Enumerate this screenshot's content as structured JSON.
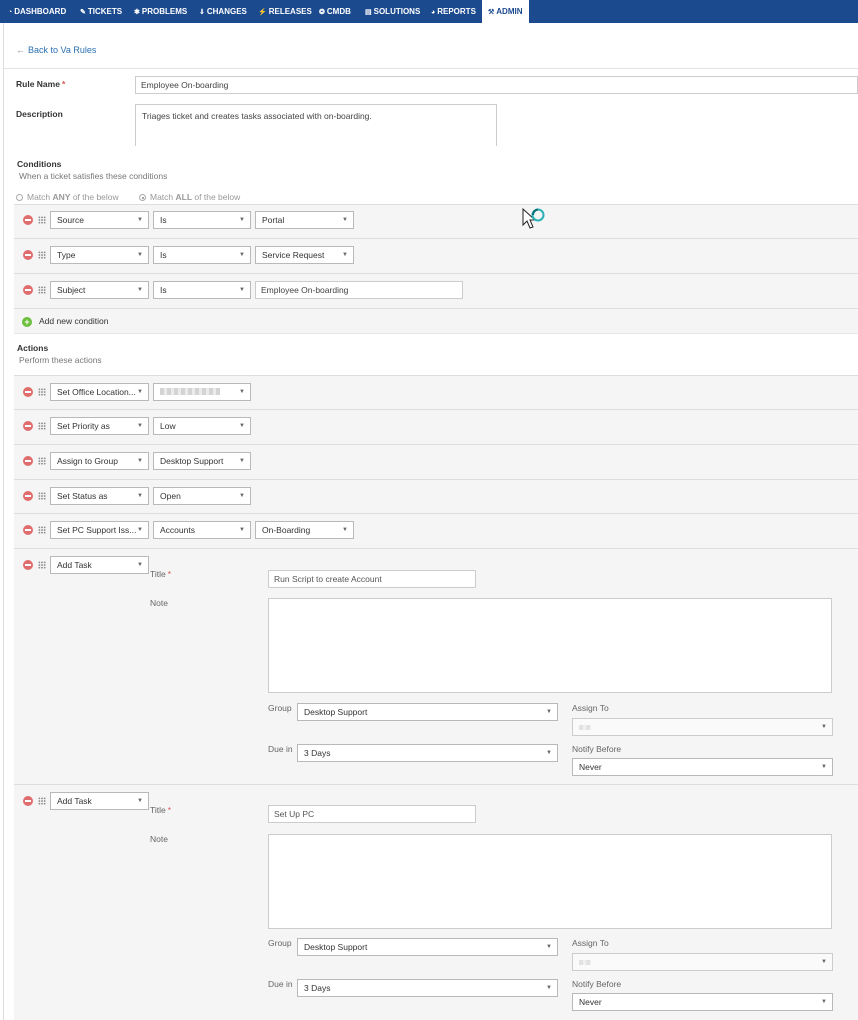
{
  "nav": {
    "items": [
      {
        "label": "DASHBOARD"
      },
      {
        "label": "TICKETS"
      },
      {
        "label": "PROBLEMS"
      },
      {
        "label": "CHANGES"
      },
      {
        "label": "RELEASES"
      },
      {
        "label": "CMDB"
      },
      {
        "label": "SOLUTIONS"
      },
      {
        "label": "REPORTS"
      },
      {
        "label": "ADMIN"
      }
    ]
  },
  "back_link": "Back to Va Rules",
  "form": {
    "rule_name_label": "Rule Name",
    "rule_name_value": "Employee On-boarding",
    "description_label": "Description",
    "description_value": "Triages ticket and creates tasks associated with on-boarding.",
    "required_mark": "*"
  },
  "conditions": {
    "heading": "Conditions",
    "subheading": "When a ticket satisfies these conditions",
    "match_any_pre": "Match ",
    "match_any_bold": "ANY",
    "match_any_post": " of the below",
    "match_all_pre": "Match ",
    "match_all_bold": "ALL",
    "match_all_post": " of the below",
    "rows": [
      {
        "field": "Source",
        "operator": "Is",
        "value": "Portal"
      },
      {
        "field": "Type",
        "operator": "Is",
        "value": "Service Request"
      },
      {
        "field": "Subject",
        "operator": "Is",
        "value": "Employee On-boarding"
      }
    ],
    "add_label": "Add new condition"
  },
  "actions": {
    "heading": "Actions",
    "subheading": "Perform these actions",
    "rows": [
      {
        "action": "Set Office Location...",
        "value": ""
      },
      {
        "action": "Set Priority as",
        "value": "Low"
      },
      {
        "action": "Assign to Group",
        "value": "Desktop Support"
      },
      {
        "action": "Set Status as",
        "value": "Open"
      },
      {
        "action": "Set PC Support Iss...",
        "value": "Accounts",
        "value2": "On-Boarding"
      }
    ],
    "tasks": [
      {
        "action": "Add Task",
        "title_label": "Title",
        "title_value": "Run Script to create Account",
        "note_label": "Note",
        "group_label": "Group",
        "group_value": "Desktop Support",
        "assign_label": "Assign To",
        "due_label": "Due in",
        "due_value": "3 Days",
        "notify_label": "Notify Before",
        "notify_value": "Never"
      },
      {
        "action": "Add Task",
        "title_label": "Title",
        "title_value": "Set Up PC",
        "note_label": "Note",
        "group_label": "Group",
        "group_value": "Desktop Support",
        "assign_label": "Assign To",
        "due_label": "Due in",
        "due_value": "3 Days",
        "notify_label": "Notify Before",
        "notify_value": "Never"
      }
    ]
  },
  "colors": {
    "nav_bg": "#1c4a8f",
    "link": "#2a6fb0",
    "remove": "#e06d6d",
    "add": "#6bbf3b"
  }
}
